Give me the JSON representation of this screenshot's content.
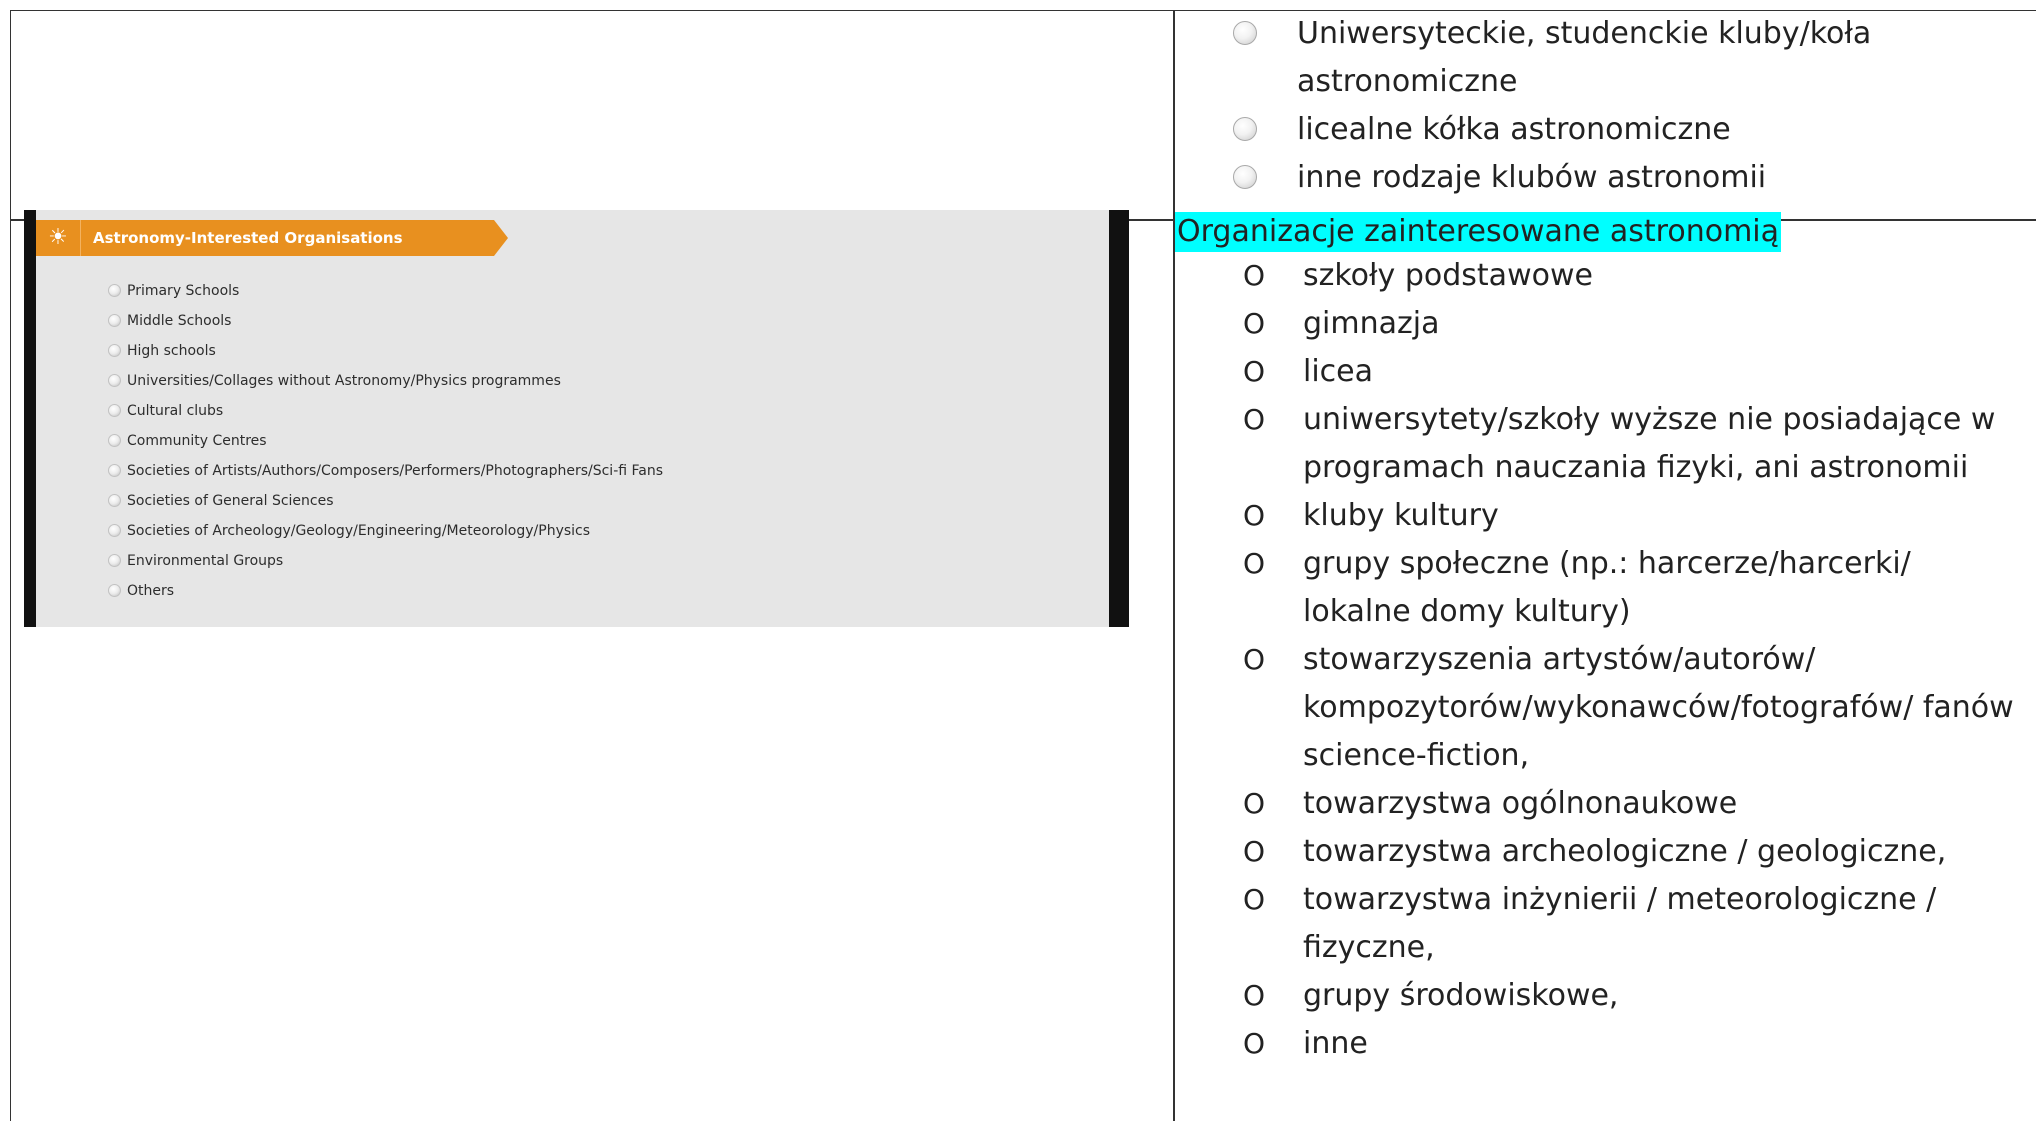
{
  "top_right": {
    "radio_items": [
      "Uniwersyteckie, studenckie kluby/koła astronomiczne",
      "licealne kółka astronomiczne",
      "inne rodzaje klubów astronomii"
    ]
  },
  "screenshot": {
    "header": "Astronomy-Interested Organisations",
    "options": [
      "Primary Schools",
      "Middle Schools",
      "High schools",
      "Universities/Collages without Astronomy/Physics programmes",
      "Cultural clubs",
      "Community Centres",
      "Societies of Artists/Authors/Composers/Performers/Photographers/Sci-fi Fans",
      "Societies of General Sciences",
      "Societies of Archeology/Geology/Engineering/Meteorology/Physics",
      "Environmental Groups",
      "Others"
    ]
  },
  "bottom_right": {
    "title": "Organizacje zainteresowane astronomią",
    "bullet": "O",
    "items": [
      "szkoły podstawowe",
      "gimnazja",
      "licea",
      "uniwersytety/szkoły wyższe nie posiadające w programach nauczania fizyki, ani astronomii",
      "kluby kultury",
      "grupy społeczne (np.: harcerze/harcerki/ lokalne domy kultury)",
      "stowarzyszenia artystów/autorów/ kompozytorów/wykonawców/fotografów/ fanów science-fiction,",
      "towarzystwa ogólnonaukowe",
      "towarzystwa archeologiczne / geologiczne,",
      "towarzystwa inżynierii / meteorologiczne / fizyczne,",
      "grupy środowiskowe,",
      "inne"
    ]
  }
}
